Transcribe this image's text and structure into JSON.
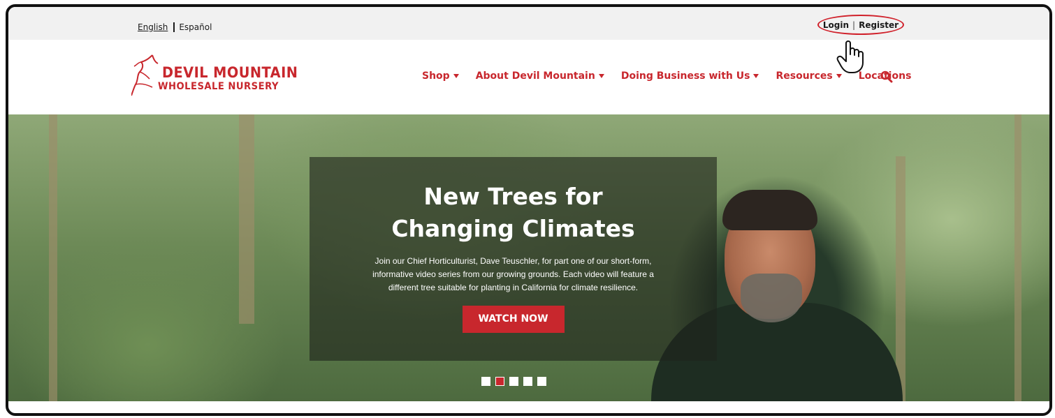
{
  "utility": {
    "lang_primary": "English",
    "lang_alt": "Español",
    "login": "Login",
    "separator": "|",
    "register": "Register"
  },
  "logo": {
    "line1": "DEVIL MOUNTAIN",
    "line2": "WHOLESALE NURSERY",
    "brand_color": "#c8272d"
  },
  "nav": {
    "items": [
      {
        "label": "Shop",
        "dropdown": true
      },
      {
        "label": "About Devil Mountain",
        "dropdown": true
      },
      {
        "label": "Doing Business with Us",
        "dropdown": true
      },
      {
        "label": "Resources",
        "dropdown": true
      },
      {
        "label": "Locations",
        "dropdown": false
      }
    ],
    "search_icon": "search-icon"
  },
  "hero": {
    "title": "New Trees for Changing Climates",
    "body": "Join our Chief Horticulturist, Dave Teuschler, for part one of our short-form, informative video series from our growing grounds. Each video will feature a different tree suitable for planting in California for climate resilience.",
    "cta": "WATCH NOW",
    "slides_total": 5,
    "slide_active": 2
  },
  "colors": {
    "accent": "#c8272d",
    "annotation_circle": "#d0202a"
  }
}
